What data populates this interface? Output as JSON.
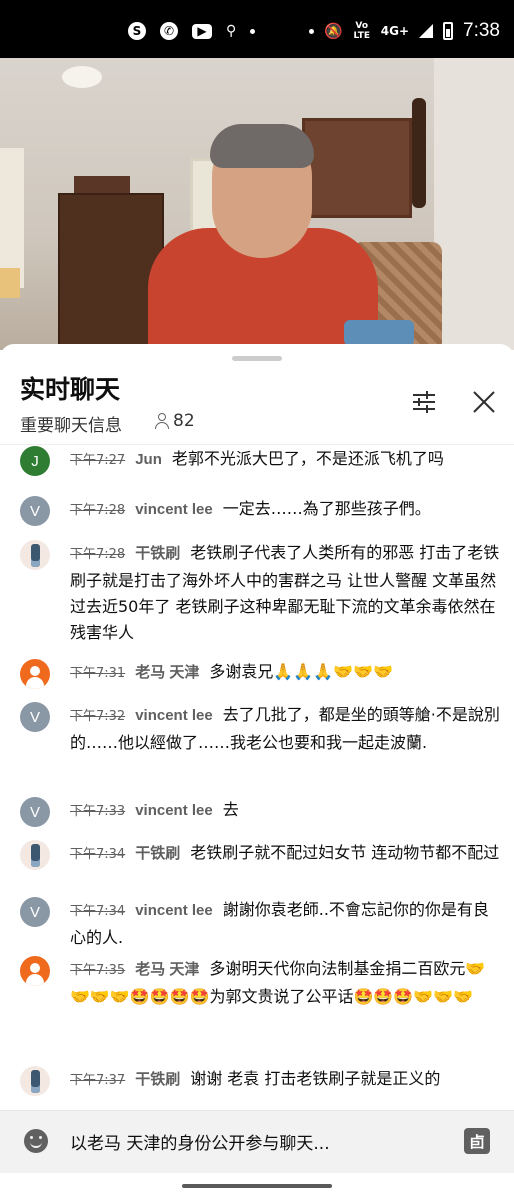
{
  "status_bar": {
    "time": "7:38",
    "network": "4G+",
    "volte": "Vo LTE",
    "icons": [
      "skype-icon",
      "whatsapp-icon",
      "youtube-icon",
      "usb-icon",
      "dot-icon",
      "mute-icon",
      "signal-icon",
      "battery-icon"
    ]
  },
  "chat": {
    "title": "实时聊天",
    "mode_label": "重要聊天信息",
    "viewer_count": "82",
    "input_placeholder": "以老马 天津的身份公开参与聊天...",
    "superchat_glyph": "卣"
  },
  "messages": [
    {
      "time": "下午7:27",
      "author": "Jun",
      "avatar": "J",
      "avatar_type": "green",
      "text": "老郭不光派大巴了，不是还派飞机了吗"
    },
    {
      "time": "下午7:28",
      "author": "vincent lee",
      "avatar": "V",
      "avatar_type": "grey",
      "text": "一定去……為了那些孩子們。"
    },
    {
      "time": "下午7:28",
      "author": "干铁刷",
      "avatar": "",
      "avatar_type": "bottle",
      "text": "老铁刷子代表了人类所有的邪恶 打击了老铁刷子就是打击了海外坏人中的害群之马 让世人警醒 文革虽然过去近50年了 老铁刷子这种卑鄙无耻下流的文革余毒依然在残害华人"
    },
    {
      "time": "下午7:31",
      "author": "老马 天津",
      "avatar": "",
      "avatar_type": "orange",
      "text": "多谢袁兄🙏🙏🙏🤝🤝🤝"
    },
    {
      "time": "下午7:32",
      "author": "vincent lee",
      "avatar": "V",
      "avatar_type": "grey",
      "text": "去了几批了，都是坐的頭等艙·不是說別的……他以經做了……我老公也要和我一起走波蘭."
    },
    {
      "time": "下午7:33",
      "author": "vincent lee",
      "avatar": "V",
      "avatar_type": "grey",
      "text": "去"
    },
    {
      "time": "下午7:34",
      "author": "干铁刷",
      "avatar": "",
      "avatar_type": "bottle",
      "text": "老铁刷子就不配过妇女节 连动物节都不配过"
    },
    {
      "time": "下午7:34",
      "author": "vincent lee",
      "avatar": "V",
      "avatar_type": "grey",
      "text": "謝謝你袁老師..不會忘記你的你是有良心的人."
    },
    {
      "time": "下午7:35",
      "author": "老马 天津",
      "avatar": "",
      "avatar_type": "orange",
      "text": "多谢明天代你向法制基金捐二百欧元🤝🤝🤝🤝🤩🤩🤩🤩为郭文贵说了公平话🤩🤩🤩🤝🤝🤝"
    },
    {
      "time": "下午7:37",
      "author": "干铁刷",
      "avatar": "",
      "avatar_type": "bottle",
      "text": "谢谢 老袁 打击老铁刷子就是正义的"
    }
  ]
}
